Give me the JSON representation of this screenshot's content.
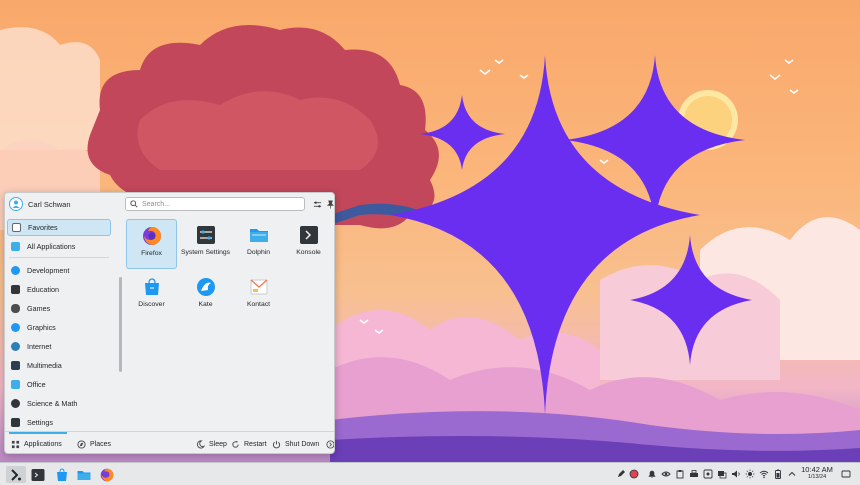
{
  "user": {
    "name": "Carl Schwan"
  },
  "search": {
    "placeholder": "Search..."
  },
  "sidebar": {
    "items": [
      {
        "label": "Favorites",
        "color": "#ffffff"
      },
      {
        "label": "All Applications",
        "color": "#3daee9"
      },
      {
        "label": "Development",
        "color": "#1d99f3"
      },
      {
        "label": "Education",
        "color": "#31363b"
      },
      {
        "label": "Games",
        "color": "#4d4d4d"
      },
      {
        "label": "Graphics",
        "color": "#1d99f3"
      },
      {
        "label": "Internet",
        "color": "#2980b9"
      },
      {
        "label": "Multimedia",
        "color": "#2c3e50"
      },
      {
        "label": "Office",
        "color": "#3daee9"
      },
      {
        "label": "Science & Math",
        "color": "#31363b"
      },
      {
        "label": "Settings",
        "color": "#31363b"
      }
    ]
  },
  "apps": [
    {
      "label": "Firefox",
      "icon": "firefox-icon"
    },
    {
      "label": "System Settings",
      "icon": "settings-icon"
    },
    {
      "label": "Dolphin",
      "icon": "folder-icon"
    },
    {
      "label": "Konsole",
      "icon": "terminal-icon"
    },
    {
      "label": "Discover",
      "icon": "store-icon"
    },
    {
      "label": "Kate",
      "icon": "kate-icon"
    },
    {
      "label": "Kontact",
      "icon": "kontact-icon"
    }
  ],
  "footer": {
    "applications": "Applications",
    "places": "Places",
    "sleep": "Sleep",
    "restart": "Restart",
    "shutdown": "Shut Down"
  },
  "clock": {
    "time": "10:42 AM",
    "date": "1/13/24"
  },
  "colors": {
    "accent": "#3daee9",
    "panel": "#eff0f1",
    "sparkle": "#6a2ef0"
  }
}
